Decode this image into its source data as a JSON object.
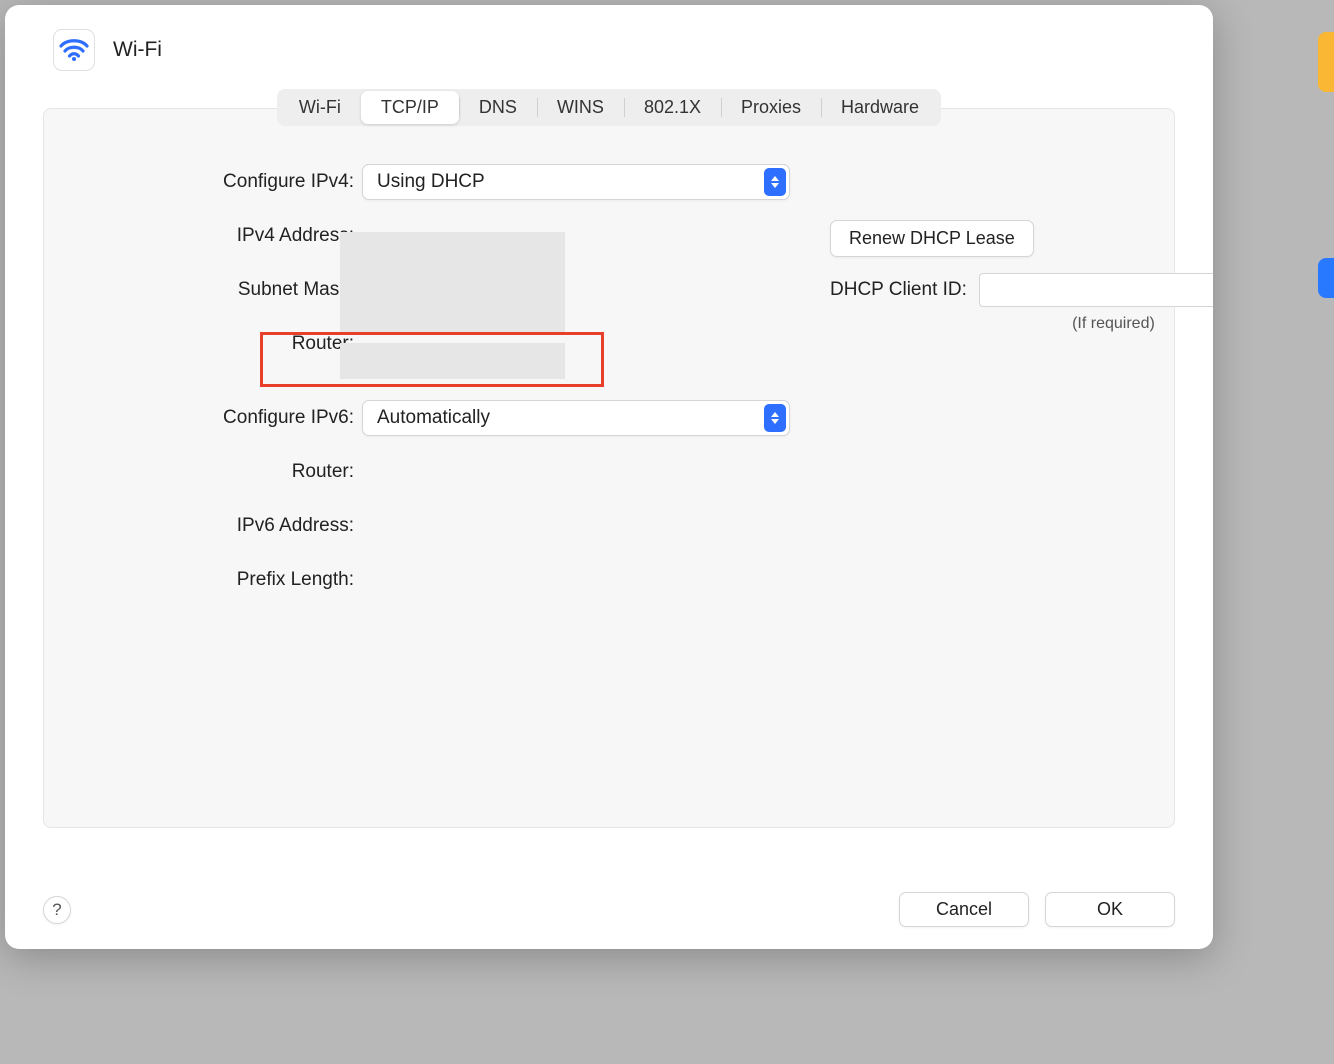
{
  "header": {
    "title": "Wi-Fi",
    "icon": "wifi-icon"
  },
  "tabs": [
    {
      "label": "Wi-Fi",
      "active": false
    },
    {
      "label": "TCP/IP",
      "active": true
    },
    {
      "label": "DNS",
      "active": false
    },
    {
      "label": "WINS",
      "active": false
    },
    {
      "label": "802.1X",
      "active": false
    },
    {
      "label": "Proxies",
      "active": false
    },
    {
      "label": "Hardware",
      "active": false
    }
  ],
  "ipv4": {
    "configure_label": "Configure IPv4:",
    "configure_value": "Using DHCP",
    "address_label": "IPv4 Address:",
    "subnet_label": "Subnet Mask:",
    "router_label": "Router:"
  },
  "ipv6": {
    "configure_label": "Configure IPv6:",
    "configure_value": "Automatically",
    "router_label": "Router:",
    "address_label": "IPv6 Address:",
    "prefix_label": "Prefix Length:"
  },
  "dhcp": {
    "renew_label": "Renew DHCP Lease",
    "client_id_label": "DHCP Client ID:",
    "client_id_value": "",
    "if_required": "(If required)"
  },
  "footer": {
    "help": "?",
    "cancel": "Cancel",
    "ok": "OK"
  }
}
